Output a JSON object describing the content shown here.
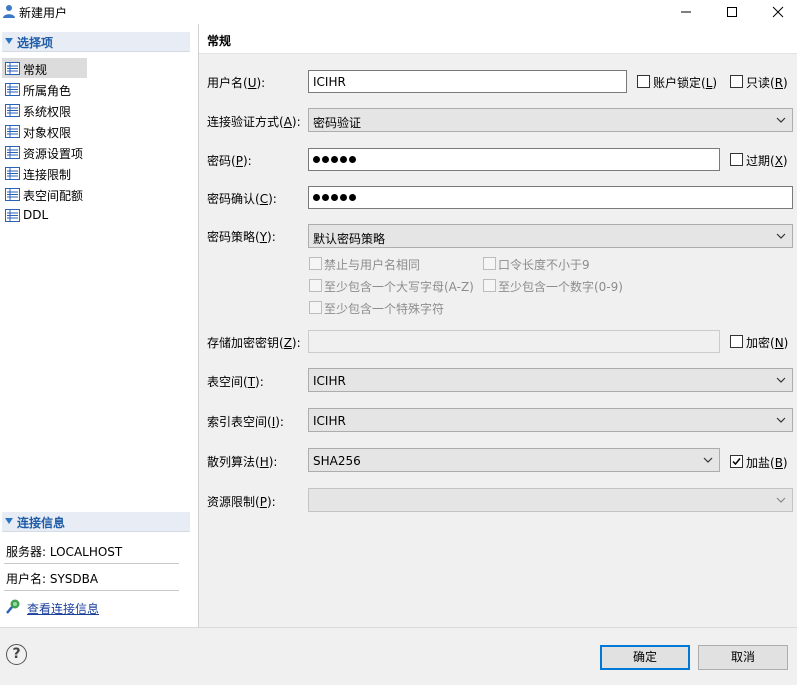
{
  "window": {
    "title": "新建用户",
    "icons": {
      "app": "user-icon",
      "minimize": "minimize-icon",
      "maximize": "maximize-icon",
      "close": "close-icon"
    }
  },
  "sidebar": {
    "section_title": "选择项",
    "items": [
      {
        "label": "常规",
        "selected": true
      },
      {
        "label": "所属角色"
      },
      {
        "label": "系统权限"
      },
      {
        "label": "对象权限"
      },
      {
        "label": "资源设置项"
      },
      {
        "label": "连接限制"
      },
      {
        "label": "表空间配额"
      },
      {
        "label": "DDL"
      }
    ],
    "item_icon": "property-sheet-icon"
  },
  "connection": {
    "section_title": "连接信息",
    "server": "服务器: LOCALHOST",
    "user": "用户名: SYSDBA",
    "link": "查看连接信息"
  },
  "page": {
    "title": "常规",
    "username_label": "用户名(",
    "username_key": "U",
    "username_suffix": "):",
    "username_value": "ICIHR",
    "account_lock_label": "账户锁定(",
    "account_lock_key": "L",
    "account_lock_suffix": ")",
    "readonly_label": "只读(",
    "readonly_key": "R",
    "readonly_suffix": ")",
    "auth_label": "连接验证方式(",
    "auth_key": "A",
    "auth_suffix": "):",
    "auth_value": "密码验证",
    "password_label": "密码(",
    "password_key": "P",
    "password_suffix": "):",
    "expired_label": "过期(",
    "expired_key": "X",
    "expired_suffix": ")",
    "confirm_label": "密码确认(",
    "confirm_key": "C",
    "confirm_suffix": "):",
    "policy_label": "密码策略(",
    "policy_key": "Y",
    "policy_suffix": "):",
    "policy_value": "默认密码策略",
    "policy_options": [
      "禁止与用户名相同",
      "口令长度不小于9",
      "至少包含一个大写字母(A-Z)",
      "至少包含一个数字(0-9)",
      "至少包含一个特殊字符"
    ],
    "storage_key_label": "存储加密密钥(",
    "storage_key_key": "Z",
    "storage_key_suffix": "):",
    "encrypt_label": "加密(",
    "encrypt_key": "N",
    "encrypt_suffix": ")",
    "tablespace_label": "表空间(",
    "tablespace_key": "T",
    "tablespace_suffix": "):",
    "tablespace_value": "ICIHR",
    "index_tablespace_label": "索引表空间(",
    "index_tablespace_key": "I",
    "index_tablespace_suffix": "):",
    "index_tablespace_value": "ICIHR",
    "hash_label": "散列算法(",
    "hash_key": "H",
    "hash_suffix": "):",
    "hash_value": "SHA256",
    "salt_label": "加盐(",
    "salt_key": "B",
    "salt_suffix": ")",
    "salt_checked": true,
    "resource_label": "资源限制(",
    "resource_key": "P",
    "resource_suffix": "):",
    "resource_value": ""
  },
  "footer": {
    "ok": "确定",
    "cancel": "取消",
    "help_icon": "help-icon"
  }
}
